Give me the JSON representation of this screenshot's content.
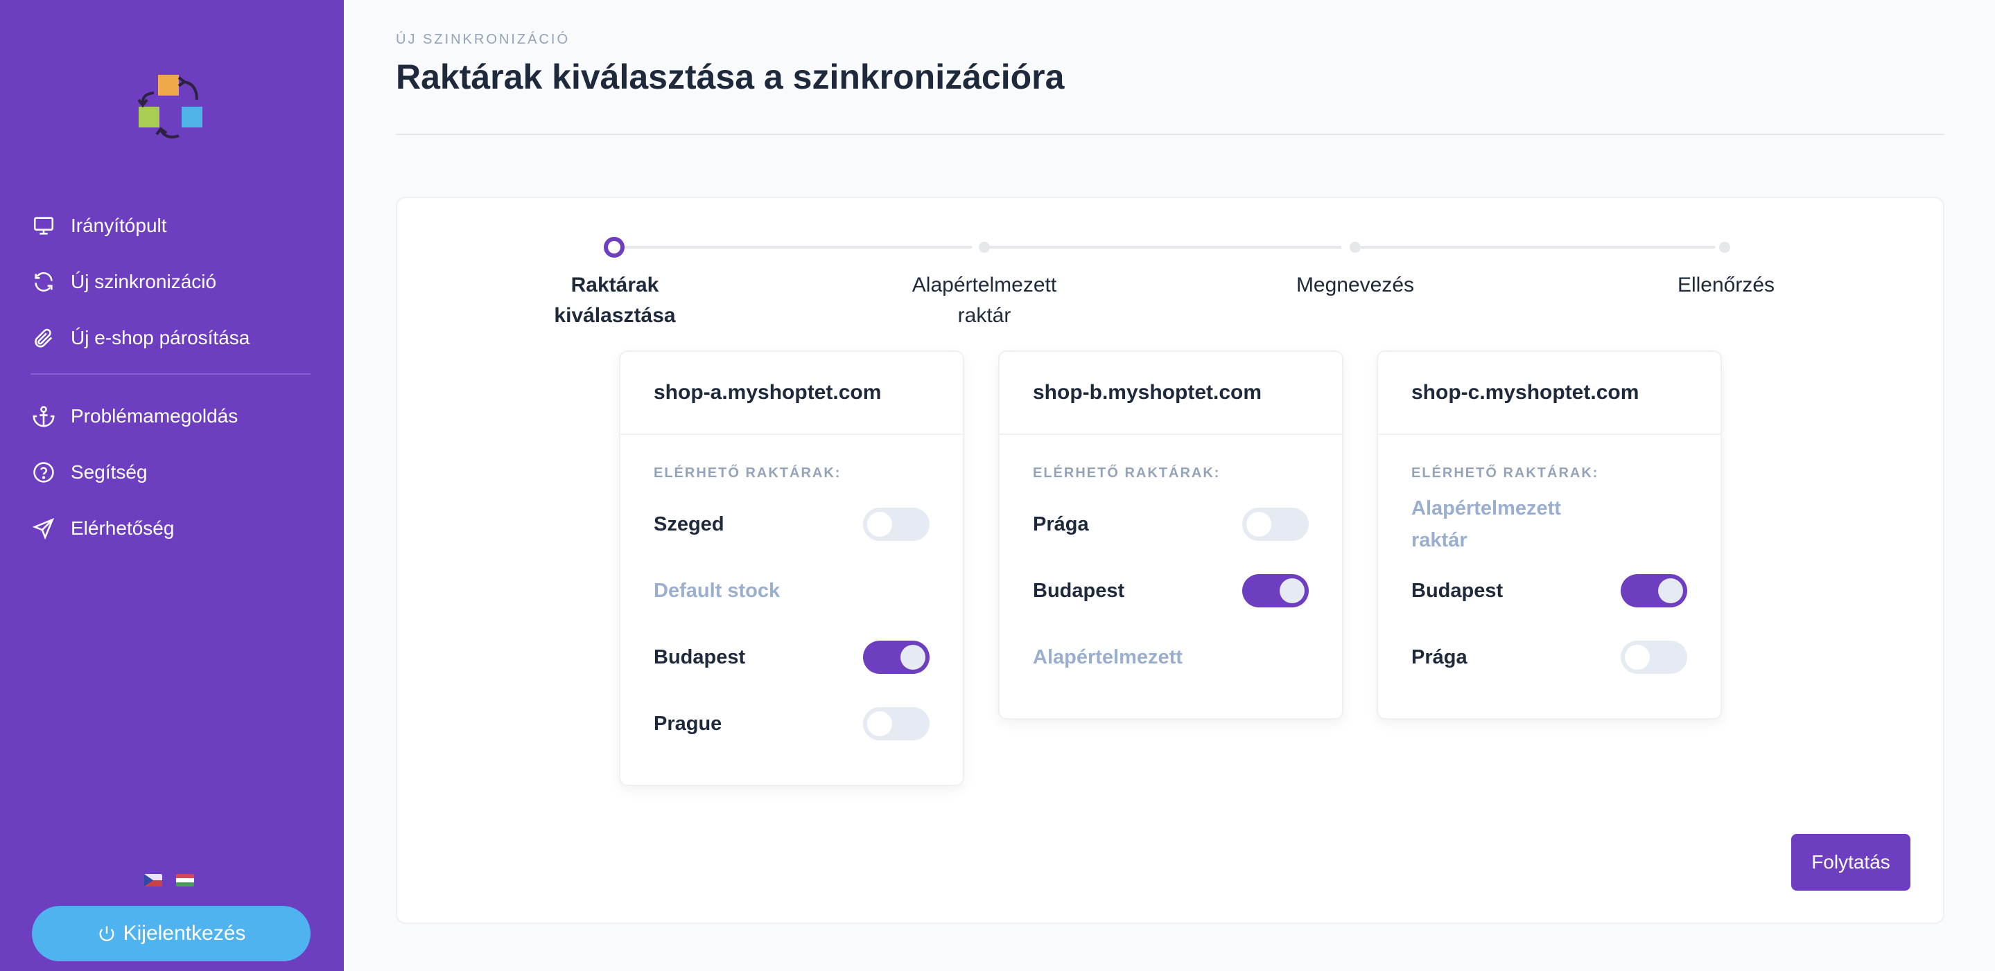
{
  "sidebar": {
    "nav": [
      {
        "label": "Irányítópult",
        "icon": "monitor-icon"
      },
      {
        "label": "Új szinkronizáció",
        "icon": "refresh-icon"
      },
      {
        "label": "Új e-shop párosítása",
        "icon": "paperclip-icon"
      },
      {
        "label": "Problémamegoldás",
        "icon": "anchor-icon"
      },
      {
        "label": "Segítség",
        "icon": "help-circle-icon"
      },
      {
        "label": "Elérhetőség",
        "icon": "send-icon"
      }
    ],
    "logout_label": "Kijelentkezés"
  },
  "header": {
    "eyebrow": "ÚJ SZINKRONIZÁCIÓ",
    "title": "Raktárak kiválasztása a szinkronizációra"
  },
  "stepper": {
    "steps": [
      {
        "line1": "Raktárak",
        "line2": "kiválasztása",
        "active": true
      },
      {
        "line1": "Alapértelmezett",
        "line2": "raktár",
        "active": false
      },
      {
        "line1": "Megnevezés",
        "line2": "",
        "active": false
      },
      {
        "line1": "Ellenőrzés",
        "line2": "",
        "active": false
      }
    ]
  },
  "cards": [
    {
      "shop": "shop-a.myshoptet.com",
      "subtitle": "ELÉRHETŐ RAKTÁRAK:",
      "warehouses": [
        {
          "name": "Szeged",
          "toggle": "off"
        },
        {
          "name": "Default stock",
          "toggle": "none"
        },
        {
          "name": "Budapest",
          "toggle": "on"
        },
        {
          "name": "Prague",
          "toggle": "off"
        }
      ]
    },
    {
      "shop": "shop-b.myshoptet.com",
      "subtitle": "ELÉRHETŐ RAKTÁRAK:",
      "warehouses": [
        {
          "name": "Prága",
          "toggle": "off"
        },
        {
          "name": "Budapest",
          "toggle": "on"
        },
        {
          "name": "Alapértelmezett",
          "toggle": "none"
        }
      ]
    },
    {
      "shop": "shop-c.myshoptet.com",
      "subtitle": "ELÉRHETŐ RAKTÁRAK:",
      "warehouses": [
        {
          "name": "Alapértelmezett raktár",
          "toggle": "none"
        },
        {
          "name": "Budapest",
          "toggle": "on"
        },
        {
          "name": "Prága",
          "toggle": "off"
        }
      ]
    }
  ],
  "actions": {
    "continue_label": "Folytatás"
  },
  "colors": {
    "sidebar": "#6d3fc0",
    "accent": "#6d3fc0",
    "logout": "#4fb3f0"
  }
}
